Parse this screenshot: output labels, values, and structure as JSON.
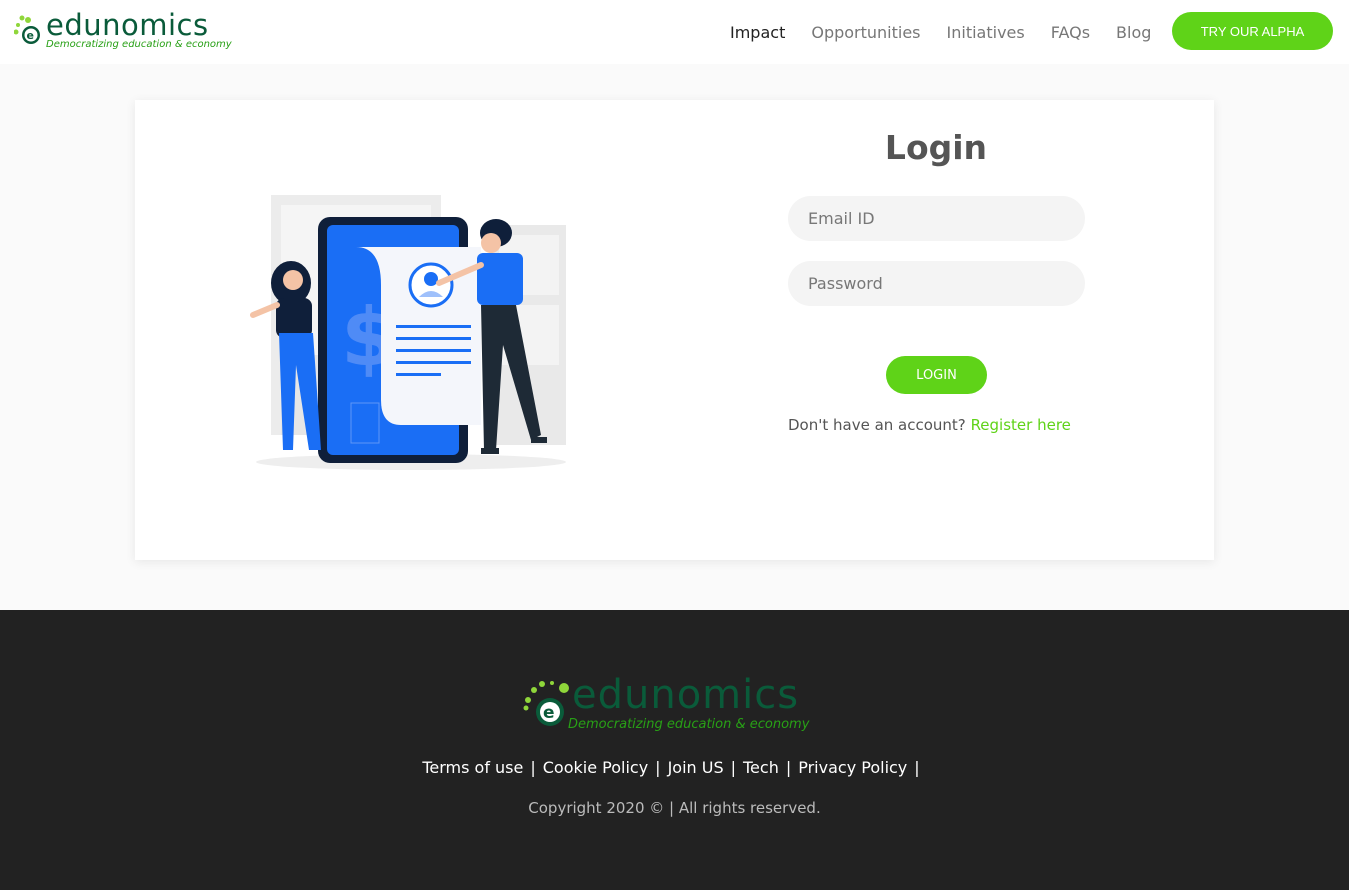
{
  "header": {
    "logo_word": "edunomics",
    "logo_tagline": "Democratizing education & economy",
    "nav": [
      "Impact",
      "Opportunities",
      "Initiatives",
      "FAQs",
      "Blog"
    ],
    "cta_label": "TRY OUR ALPHA"
  },
  "login": {
    "title": "Login",
    "email_placeholder": "Email ID",
    "password_placeholder": "Password",
    "button_label": "LOGIN",
    "register_prompt": "Don't have an account?",
    "register_link": "Register here"
  },
  "footer": {
    "logo_word": "edunomics",
    "logo_tagline": "Democratizing education & economy",
    "links": [
      "Terms of use",
      "Cookie Policy",
      "Join US",
      "Tech",
      "Privacy Policy"
    ],
    "copyright": "Copyright 2020 © | All rights reserved."
  },
  "colors": {
    "accent": "#5fd318",
    "brand_dark": "#0a5b3a",
    "footer_bg": "#222222",
    "illustration_blue": "#1a6ef5"
  }
}
